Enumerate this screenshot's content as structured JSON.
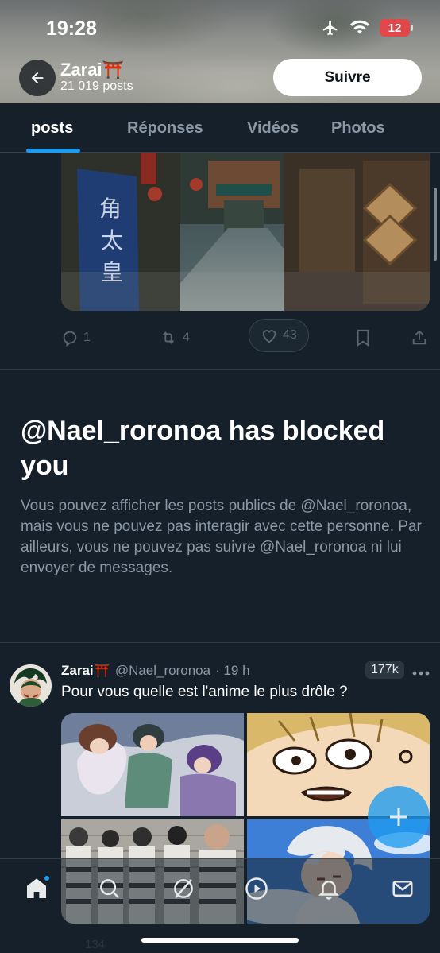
{
  "status_bar": {
    "time": "19:28",
    "battery": "12"
  },
  "profile": {
    "name": "Zarai",
    "emoji": "⛩️",
    "post_count": "21 019 posts",
    "follow_label": "Suivre"
  },
  "tabs": [
    {
      "label": "posts",
      "active": true
    },
    {
      "label": "Réponses",
      "active": false
    },
    {
      "label": "Vidéos",
      "active": false
    },
    {
      "label": "Photos",
      "active": false
    }
  ],
  "top_post": {
    "replies": "1",
    "reposts": "4",
    "likes": "43"
  },
  "blocked": {
    "title": "@Nael_roronoa has blocked you",
    "message": "Vous pouvez afficher les posts publics de @Nael_roronoa, mais vous ne pouvez pas interagir avec cette personne. Par ailleurs, vous ne pouvez pas suivre @Nael_roronoa ni lui envoyer de messages."
  },
  "post": {
    "author": "Zarai",
    "emoji": "⛩️",
    "handle": "@Nael_roronoa",
    "time": "· 19 h",
    "views_badge": "177k",
    "text": "Pour vous quelle est l'anime le plus drôle ?",
    "replies": "134"
  },
  "nav": [
    "home-icon",
    "search-icon",
    "grok-icon",
    "play-icon",
    "bell-icon",
    "mail-icon"
  ],
  "colors": {
    "background": "#15202b",
    "accent": "#1d9bf0",
    "muted": "#8b98a5"
  }
}
